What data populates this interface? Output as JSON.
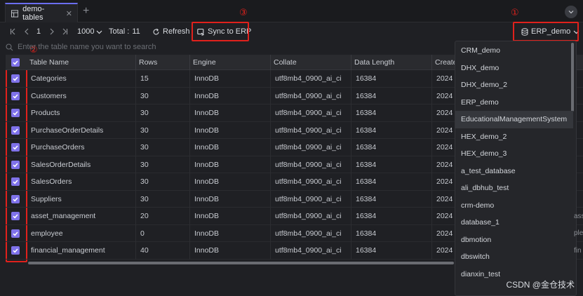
{
  "tab": {
    "title": "demo-tables",
    "close": "✕",
    "add": "+"
  },
  "toolbar": {
    "page": "1",
    "page_size": "1000",
    "total_label": "Total :",
    "total_value": "11",
    "refresh": "Refresh",
    "sync": "Sync to ERP",
    "db_selected": "ERP_demo"
  },
  "markers": {
    "m1": "①",
    "m2": "②",
    "m3": "③"
  },
  "search": {
    "placeholder": "Enter the table name you want to search"
  },
  "columns": [
    "Table Name",
    "Rows",
    "Engine",
    "Collate",
    "Data Length",
    "Create"
  ],
  "rows": [
    {
      "name": "Categories",
      "rows": "15",
      "engine": "InnoDB",
      "collate": "utf8mb4_0900_ai_ci",
      "length": "16384",
      "create": "2024"
    },
    {
      "name": "Customers",
      "rows": "30",
      "engine": "InnoDB",
      "collate": "utf8mb4_0900_ai_ci",
      "length": "16384",
      "create": "2024"
    },
    {
      "name": "Products",
      "rows": "30",
      "engine": "InnoDB",
      "collate": "utf8mb4_0900_ai_ci",
      "length": "16384",
      "create": "2024"
    },
    {
      "name": "PurchaseOrderDetails",
      "rows": "30",
      "engine": "InnoDB",
      "collate": "utf8mb4_0900_ai_ci",
      "length": "16384",
      "create": "2024"
    },
    {
      "name": "PurchaseOrders",
      "rows": "30",
      "engine": "InnoDB",
      "collate": "utf8mb4_0900_ai_ci",
      "length": "16384",
      "create": "2024"
    },
    {
      "name": "SalesOrderDetails",
      "rows": "30",
      "engine": "InnoDB",
      "collate": "utf8mb4_0900_ai_ci",
      "length": "16384",
      "create": "2024"
    },
    {
      "name": "SalesOrders",
      "rows": "30",
      "engine": "InnoDB",
      "collate": "utf8mb4_0900_ai_ci",
      "length": "16384",
      "create": "2024"
    },
    {
      "name": "Suppliers",
      "rows": "30",
      "engine": "InnoDB",
      "collate": "utf8mb4_0900_ai_ci",
      "length": "16384",
      "create": "2024"
    },
    {
      "name": "asset_management",
      "rows": "20",
      "engine": "InnoDB",
      "collate": "utf8mb4_0900_ai_ci",
      "length": "16384",
      "create": "2024"
    },
    {
      "name": "employee",
      "rows": "0",
      "engine": "InnoDB",
      "collate": "utf8mb4_0900_ai_ci",
      "length": "16384",
      "create": "2024"
    },
    {
      "name": "financial_management",
      "rows": "40",
      "engine": "InnoDB",
      "collate": "utf8mb4_0900_ai_ci",
      "length": "16384",
      "create": "2024"
    }
  ],
  "edge_fragments": [
    "ass",
    "ple",
    "fin"
  ],
  "databases": [
    "CRM_demo",
    "DHX_demo",
    "DHX_demo_2",
    "ERP_demo",
    "EducationalManagementSystem",
    "HEX_demo_2",
    "HEX_demo_3",
    "a_test_database",
    "ali_dbhub_test",
    "crm-demo",
    "database_1",
    "dbmotion",
    "dbswitch",
    "dianxin_test"
  ],
  "watermark": "CSDN @金仓技术",
  "colors": {
    "accent": "#7f72ea",
    "highlight": "#e0211c"
  }
}
